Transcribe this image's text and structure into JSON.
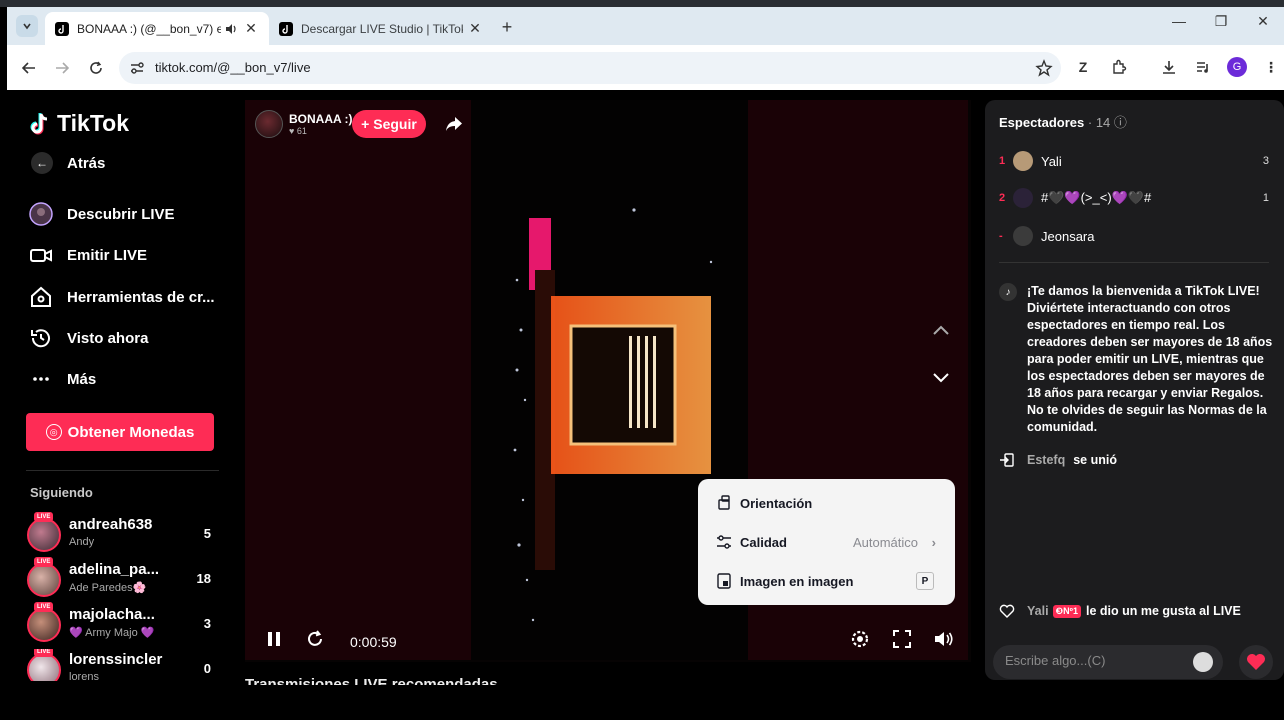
{
  "browser": {
    "tabs": [
      {
        "title": "BONAAA :) (@__bon_v7) e",
        "active": true
      },
      {
        "title": "Descargar LIVE Studio | TikTok",
        "active": false
      }
    ],
    "new_tab": "+",
    "url": "tiktok.com/@__bon_v7/live",
    "profile_initial": "G"
  },
  "sidebar": {
    "logo": "TikTok",
    "back": "Atrás",
    "nav": [
      {
        "label": "Descubrir LIVE",
        "icon": "live-avatar-icon"
      },
      {
        "label": "Emitir LIVE",
        "icon": "camera-icon"
      },
      {
        "label": "Herramientas de cr...",
        "icon": "home-tools-icon"
      },
      {
        "label": "Visto ahora",
        "icon": "history-icon"
      },
      {
        "label": "Más",
        "icon": "more-dots-icon"
      }
    ],
    "coins_button": "Obtener Monedas",
    "following_title": "Siguiendo",
    "following": [
      {
        "name": "andreah638",
        "sub": "Andy",
        "count": "5"
      },
      {
        "name": "adelina_pa...",
        "sub": "Ade Paredes🌸",
        "count": "18"
      },
      {
        "name": "majolacha...",
        "sub": "💜 Army Majo 💜",
        "count": "3"
      },
      {
        "name": "lorenssincler",
        "sub": "lorens",
        "count": "0"
      }
    ],
    "live_badge": "LIVE"
  },
  "video": {
    "host_name": "BONAAA :)",
    "host_likes": "♥ 61",
    "follow_button": "+ Seguir",
    "time": "0:00:59",
    "caption_partial": "Transmisiones LIVE recomendadas"
  },
  "settings_menu": {
    "orientation": "Orientación",
    "quality": "Calidad",
    "quality_value": "Automático",
    "pip": "Imagen en imagen",
    "pip_key": "P"
  },
  "panel": {
    "viewers_title": "Espectadores",
    "viewers_count": "· 14",
    "viewers": [
      {
        "rank": "1",
        "name": "Yali",
        "score": "3",
        "color": "#b79a77"
      },
      {
        "rank": "2",
        "name": "#🖤💜(>_<)💜🖤#",
        "score": "1",
        "color": "#2b2238"
      },
      {
        "rank": "-",
        "name": "Jeonsara",
        "score": "",
        "color": "#3b3b3b"
      }
    ],
    "welcome": "¡Te damos la bienvenida a TikTok LIVE! Diviértete interactuando con otros espectadores en tiempo real. Los creadores deben ser mayores de 18 años para poder emitir un LIVE, mientras que los espectadores deben ser mayores de 18 años para recargar y enviar Regalos. No te olvides de seguir las Normas de la comunidad.",
    "joined_user": "Estefq",
    "joined_text": "se unió",
    "like_user": "Yali",
    "like_badge": "❸Nº1",
    "like_text": "le dio un me gusta al LIVE",
    "comment_placeholder": "Escribe algo...(C)"
  },
  "colors": {
    "accent": "#fe2c55",
    "panel": "#1c1c1e"
  }
}
